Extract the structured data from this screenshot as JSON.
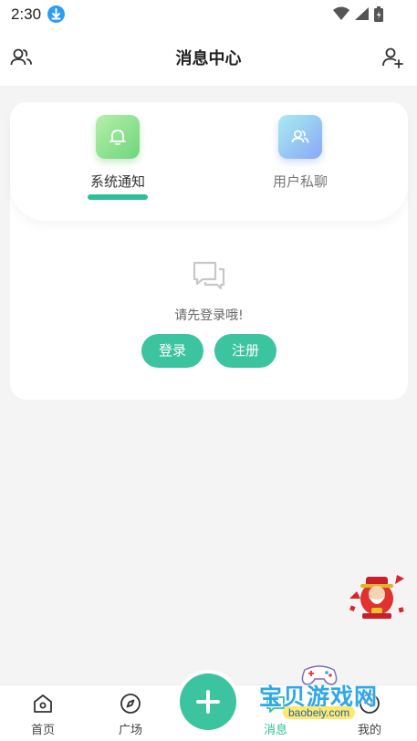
{
  "status_bar": {
    "time": "2:30"
  },
  "header": {
    "title": "消息中心"
  },
  "tabs": [
    {
      "label": "系统通知",
      "active": true
    },
    {
      "label": "用户私聊",
      "active": false
    }
  ],
  "empty_state": {
    "message": "请先登录哦!",
    "login_label": "登录",
    "register_label": "注册"
  },
  "tabbar": {
    "home_label": "首页",
    "plaza_label": "广场",
    "message_label": "消息",
    "mine_label": "我的"
  },
  "watermark": {
    "text": "宝贝游戏网",
    "url": "baobeiy.com"
  },
  "colors": {
    "accent": "#3cc4a0",
    "background": "#f4f4f4"
  }
}
